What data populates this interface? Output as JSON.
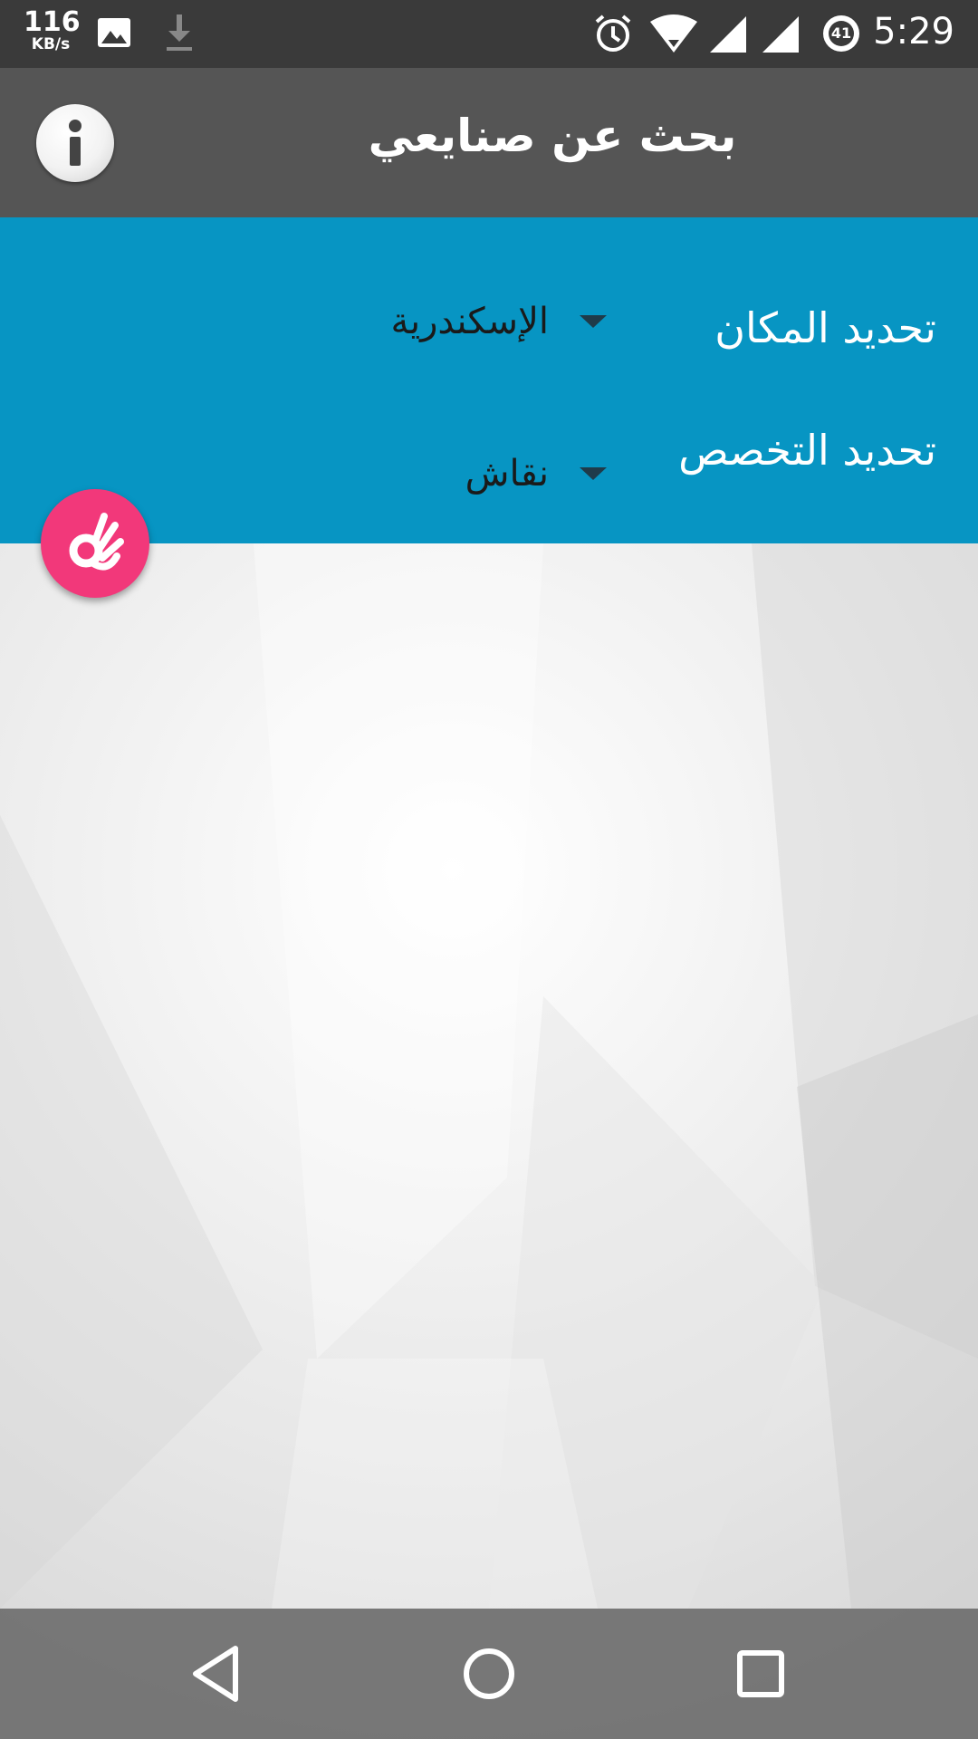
{
  "status_bar": {
    "net_speed_value": "116",
    "net_speed_unit": "KB/s",
    "battery_level": "41",
    "time": "5:29",
    "icons": [
      "image-icon",
      "download-icon",
      "alarm-icon",
      "wifi-icon",
      "cell-signal-icon",
      "cell-signal-icon",
      "battery-icon"
    ]
  },
  "app_bar": {
    "title": "بحث عن صنايعي",
    "info_icon": "info-icon"
  },
  "filters": {
    "location": {
      "label": "تحديد المكان",
      "selected": "الإسكندرية"
    },
    "specialty": {
      "label": "تحديد التخصص",
      "selected": "نقاش"
    }
  },
  "fab": {
    "icon": "ok-hand-icon",
    "color": "#f2387a"
  },
  "navigation_bar": {
    "buttons": [
      "back-icon",
      "home-icon",
      "recents-icon"
    ]
  },
  "colors": {
    "status_bar": "#3a3a3a",
    "app_bar": "#555555",
    "filter_panel": "#0795c3",
    "accent": "#f2387a"
  }
}
